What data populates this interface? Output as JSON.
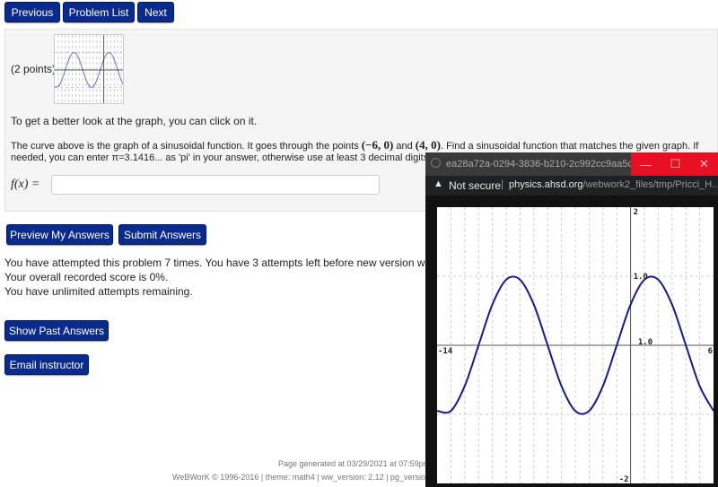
{
  "nav": {
    "previous": "Previous",
    "problem_list": "Problem List",
    "next": "Next"
  },
  "problem": {
    "points": "(2 points)",
    "hint": "To get a better look at the graph, you can click on it.",
    "line1_a": "The curve above is the graph of a sinusoidal function. It goes through the points ",
    "point1": "(−6, 0)",
    "and": " and ",
    "point2": "(4, 0)",
    "line1_b": ". Find a sinusoidal function that matches the given graph. If",
    "line2": "needed, you can enter π=3.1416... as 'pi' in your answer, otherwise use at least 3 decimal digits.",
    "answer_label": "f(x) =",
    "answer_value": ""
  },
  "actions": {
    "preview": "Preview My Answers",
    "submit": "Submit Answers",
    "show_past": "Show Past Answers",
    "email": "Email instructor"
  },
  "status": {
    "attempts": "You have attempted this problem 7 times. You have 3 attempts left before new version will be reque",
    "score": "Your overall recorded score is 0%.",
    "unlimited": "You have unlimited attempts remaining."
  },
  "footer": {
    "generated": "Page generated at 03/29/2021 at 07:59pm EDT",
    "credits": "WeBWorK © 1996-2016 | theme: math4 | ww_version: 2.12 | pg_version: 2"
  },
  "popup": {
    "title": "ea28a72a-0294-3836-b210-2c992cc9aa5c__9213...",
    "security": "Not secure",
    "url_host": "physics.ahsd.org",
    "url_path": "/webwork2_files/tmp/Pricci_H...",
    "minimize": "—",
    "maximize": "☐",
    "close": "✕"
  },
  "colors": {
    "button": "#0a2a8c",
    "curve": "#1a1a8c",
    "close_red": "#e81123"
  },
  "chart_data": {
    "type": "line",
    "xlim": [
      -14,
      6
    ],
    "ylim": [
      -2,
      2
    ],
    "grid": true,
    "tick_labels": {
      "x_min": "-14",
      "x_max": "6",
      "y_max": "2",
      "y_min": "-2",
      "y_one": "1.0",
      "x_one": "1.0"
    },
    "x": [
      -14,
      -13,
      -12,
      -11,
      -10,
      -9,
      -8,
      -7,
      -6,
      -5,
      -4,
      -3,
      -2,
      -1,
      0,
      1,
      2,
      3,
      4,
      5,
      6
    ],
    "y": [
      -0.95,
      -0.95,
      -0.59,
      0,
      0.59,
      0.95,
      0.95,
      0.59,
      0,
      -0.59,
      -0.95,
      -0.95,
      -0.59,
      0,
      0.59,
      0.95,
      0.95,
      0.59,
      0,
      -0.59,
      -0.95
    ]
  }
}
